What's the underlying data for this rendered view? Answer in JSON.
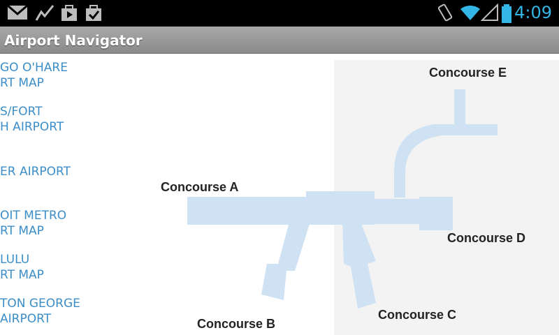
{
  "status_bar": {
    "time": "4:09",
    "left_icons": [
      "gmail-icon",
      "stocks-icon",
      "play-store-icon",
      "tasks-check-icon"
    ],
    "right_icons": [
      "rotate-icon",
      "wifi-icon",
      "signal-icon",
      "battery-icon"
    ],
    "accent_color": "#33b5e5"
  },
  "app": {
    "title": "Airport Navigator"
  },
  "airports": [
    {
      "line1": "GO O'HARE",
      "line2": "RT MAP"
    },
    {
      "line1": "S/FORT",
      "line2": "H AIRPORT"
    },
    {
      "line1": "ER AIRPORT",
      "line2": ""
    },
    {
      "line1": "OIT METRO",
      "line2": "RT MAP"
    },
    {
      "line1": "LULU",
      "line2": "RT MAP"
    },
    {
      "line1": "TON GEORGE",
      "line2": "AIRPORT"
    }
  ],
  "map": {
    "labels": {
      "concourse_a": "Concourse A",
      "concourse_b": "Concourse B",
      "concourse_c": "Concourse C",
      "concourse_d": "Concourse D",
      "concourse_e": "Concourse E"
    },
    "concourse_color": "#cfe2f4",
    "background_panel_color": "#f3f3f3"
  }
}
